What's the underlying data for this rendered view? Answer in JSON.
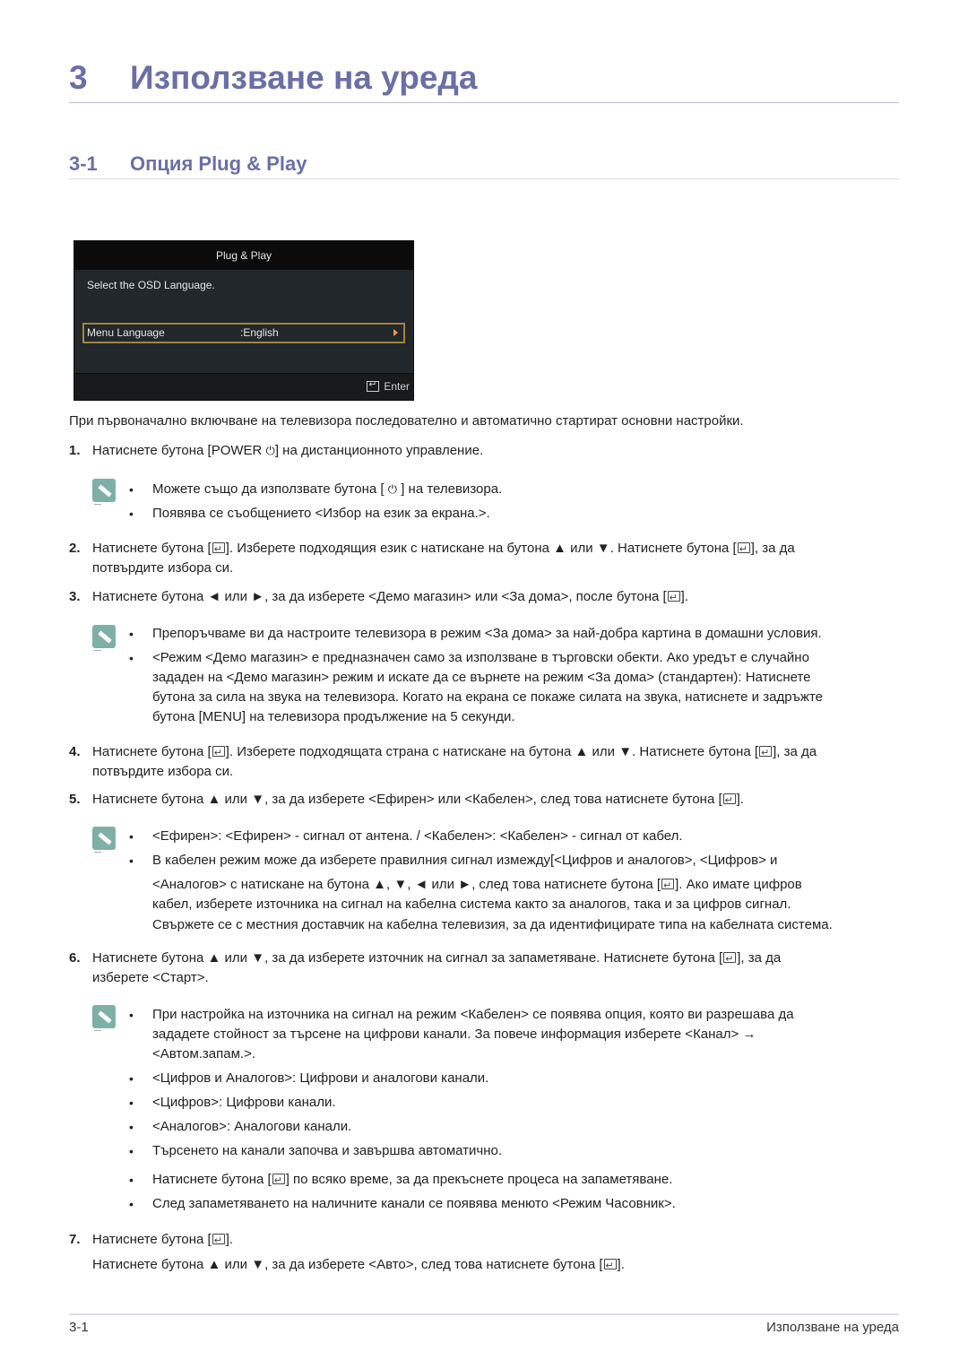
{
  "chapter": {
    "number": "3",
    "title": "Използване на уреда"
  },
  "section": {
    "number": "3-1",
    "title": "Опция Plug & Play"
  },
  "osd": {
    "title": "Plug & Play",
    "subtitle": "Select the OSD Language.",
    "row_label": "Menu Language",
    "row_value": ":English",
    "enter_label": "Enter",
    "accent_color": "#a5843b"
  },
  "intro": "При първоначално включване на телевизора последователно и автоматично стартират основни настройки.",
  "steps": [
    {
      "num": "1.",
      "lines": [
        "Натиснете бутона [POWER ⏻] на дистанционното управление."
      ]
    },
    {
      "num": "2.",
      "lines": [
        "Натиснете бутона [↵]. Изберете подходящия език с натискане на бутона ▲ или ▼. Натиснете бутона [↵], за да",
        "потвърдите избора си."
      ]
    },
    {
      "num": "3.",
      "lines": [
        "Натиснете бутона ◄ или ►, за да изберете <Демо магазин> или <За дома>, после бутона [↵]."
      ]
    },
    {
      "num": "4.",
      "lines": [
        "Натиснете бутона [↵]. Изберете подходящата страна с натискане на бутона ▲ или ▼. Натиснете бутона [↵], за да",
        "потвърдите избора си."
      ]
    },
    {
      "num": "5.",
      "lines": [
        "Натиснете бутона ▲ или ▼, за да изберете <Ефирен> или <Кабелен>, след това натиснете бутона [↵]."
      ]
    },
    {
      "num": "6.",
      "lines": [
        "Натиснете бутона ▲ или ▼, за да изберете източник на сигнал за запаметяване. Натиснете бутона [↵], за да",
        "изберете <Старт>."
      ]
    },
    {
      "num": "7.",
      "lines": [
        "Натиснете бутона [↵].",
        "Натиснете бутона ▲ или ▼, за да изберете <Авто>, след това натиснете бутона [↵]."
      ]
    }
  ],
  "notes": {
    "n1": [
      [
        "Можете също да използвате бутона [ ⏻ ] на телевизора."
      ],
      [
        "Появява се съобщението <Избор на език за екрана.>."
      ]
    ],
    "n3": [
      [
        "Препоръчваме ви да настроите телевизора в режим <За дома> за най-добра картина в домашни условия."
      ],
      [
        "<Режим <Демо магазин> е предназначен само за използване в търговски обекти. Ако уредът е случайно",
        "зададен на <Демо магазин> режим и искате да се върнете на режим <За дома> (стандартен): Натиснете",
        "бутона за сила на звука на телевизора. Когато на екрана се покаже силата на звука, натиснете и задръжте",
        "бутона [MENU] на телевизора продължение на 5 секунди."
      ]
    ],
    "n5": [
      [
        "<Ефирен>: <Ефирен> - сигнал от антена. / <Кабелен>: <Кабелен> - сигнал от кабел."
      ],
      [
        "В кабелен режим може да изберете правилния сигнал измежду[<Цифров и аналогов>, <Цифров> и",
        "<Аналогов> с натискане на бутона ▲, ▼, ◄ или ►, след това натиснете бутона [↵]. Ако имате цифров",
        "кабел, изберете източника на сигнал на кабелна система както за аналогов, така и за цифров сигнал.",
        "Свържете се с местния доставчик на кабелна телевизия, за да идентифицирате типа на кабелната система."
      ]
    ],
    "n6": [
      [
        "При настройка на източника на сигнал на режим <Кабелен> се появява опция, която ви разрешава да",
        "зададете стойност за търсене на цифрови канали. За повече информация изберете <Канал> →",
        "<Автом.запам.>."
      ],
      [
        "<Цифров и Аналогов>: Цифрови и аналогови канали."
      ],
      [
        "<Цифров>: Цифрови канали."
      ],
      [
        "<Аналогов>: Аналогови канали."
      ],
      [
        "Търсенето на канали започва и завършва автоматично."
      ],
      [
        "Натиснете бутона [↵] по всяко време, за да прекъснете процеса на запаметяване."
      ],
      [
        "След запаметяването на наличните канали се появява менюто <Режим Часовник>."
      ]
    ]
  },
  "footer": {
    "page": "3-1",
    "chapter_title": "Използване на уреда"
  }
}
